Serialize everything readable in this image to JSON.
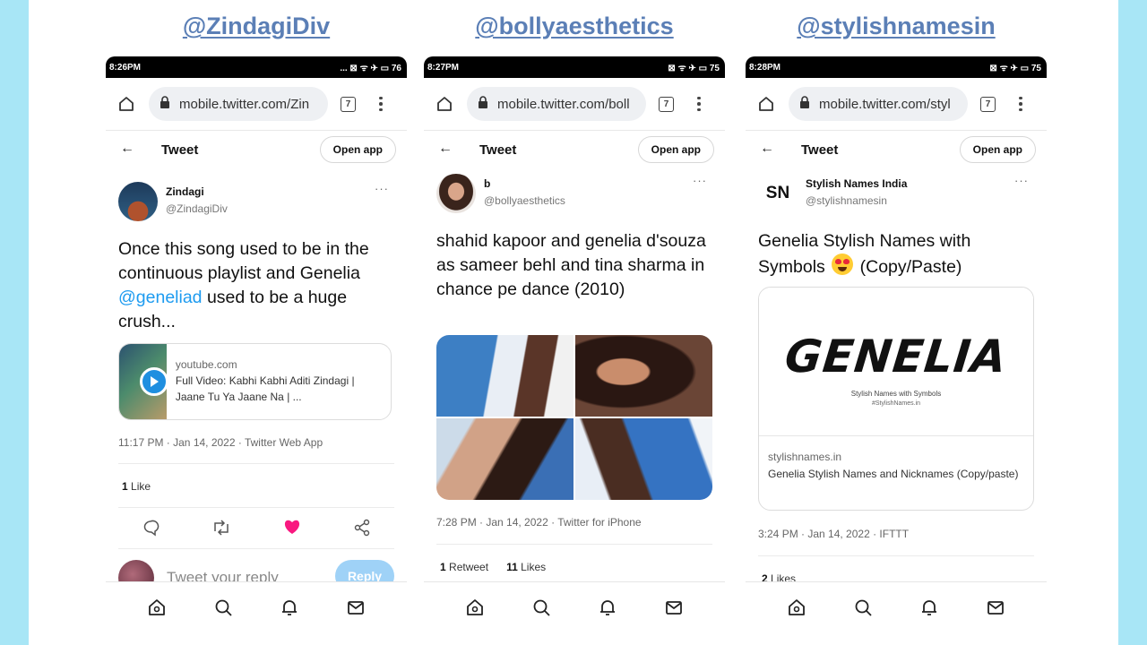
{
  "columns": [
    {
      "handle": "@ZindagiDiv",
      "status_time": "8:26PM",
      "status_icons": "... ⊠ ᯤ ✈ ▭ 76",
      "url": "mobile.twitter.com/Zin",
      "tabs_count": "7",
      "header_title": "Tweet",
      "open_app": "Open app",
      "author_name": "Zindagi",
      "author_handle": "@ZindagiDiv",
      "text_before": "Once this song used to be in the continuous playlist and Genelia ",
      "mention": "@geneliad",
      "text_after": " used to be a huge crush...",
      "link_card": {
        "domain": "youtube.com",
        "title": "Full Video: Kabhi Kabhi Aditi Zindagi | Jaane Tu Ya Jaane Na | ..."
      },
      "timestamp": "11:17 PM · Jan 14, 2022 · Twitter Web App",
      "likes_count": "1",
      "likes_label": "Like",
      "reply_placeholder": "Tweet your reply",
      "reply_button": "Reply"
    },
    {
      "handle": "@bollyaesthetics",
      "status_time": "8:27PM",
      "status_icons": "⊠ ᯤ ✈ ▭ 75",
      "url": "mobile.twitter.com/boll",
      "tabs_count": "7",
      "header_title": "Tweet",
      "open_app": "Open app",
      "author_name": "b",
      "author_handle": "@bollyaesthetics",
      "text": "shahid kapoor and genelia d'souza as sameer behl and tina sharma in chance pe dance (2010)",
      "timestamp": "7:28 PM · Jan 14, 2022 · Twitter for iPhone",
      "retweets_count": "1",
      "retweets_label": "Retweet",
      "likes_count": "11",
      "likes_label": "Likes"
    },
    {
      "handle": "@stylishnamesin",
      "status_time": "8:28PM",
      "status_icons": "⊠ ᯤ ✈ ▭ 75",
      "url": "mobile.twitter.com/styl",
      "tabs_count": "7",
      "header_title": "Tweet",
      "open_app": "Open app",
      "author_avatar_text": "SN",
      "author_name": "Stylish Names India",
      "author_handle": "@stylishnamesin",
      "text_before": "Genelia Stylish Names with Symbols ",
      "text_after": " (Copy/Paste)",
      "card": {
        "image_word": "GENELIA",
        "image_sub": "Stylish Names with Symbols",
        "image_sub2": "#StylishNames.in",
        "domain": "stylishnames.in",
        "title": "Genelia Stylish Names and Nicknames (Copy/paste)"
      },
      "timestamp": "3:24 PM · Jan 14, 2022 · IFTTT",
      "likes_count": "2",
      "likes_label": "Likes"
    }
  ],
  "colors": {
    "page_bg": "#a8e6f6",
    "handle_link": "#5b7fb6",
    "mention": "#1d9bf0",
    "like_active": "#f91880"
  },
  "icons": [
    "home-icon",
    "lock-icon",
    "tabs-icon",
    "kebab-icon",
    "back-arrow-icon",
    "more-icon",
    "play-icon",
    "reply-icon",
    "retweet-icon",
    "heart-icon",
    "share-icon",
    "search-icon",
    "bell-icon",
    "mail-icon"
  ]
}
